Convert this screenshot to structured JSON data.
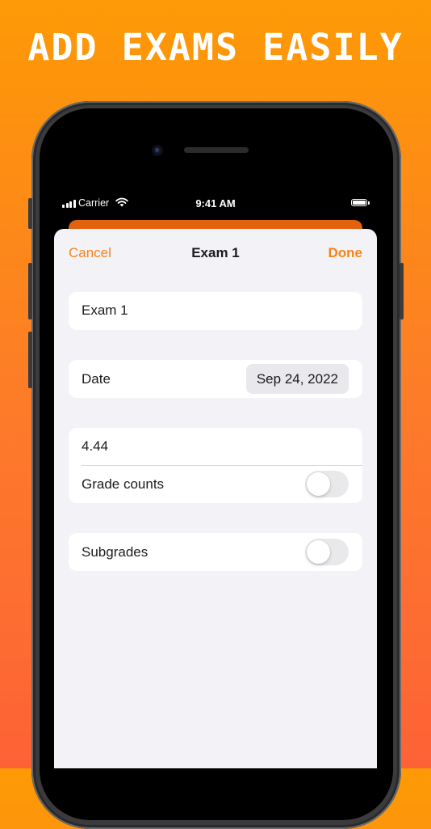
{
  "promo": {
    "headline": "ADD EXAMS EASILY"
  },
  "status_bar": {
    "carrier": "Carrier",
    "time": "9:41 AM",
    "signal_icon": "signal-bars-icon",
    "wifi_icon": "wifi-icon",
    "battery_icon": "battery-icon"
  },
  "nav": {
    "cancel_label": "Cancel",
    "title": "Exam 1",
    "done_label": "Done"
  },
  "form": {
    "name_value": "Exam 1",
    "date_label": "Date",
    "date_value": "Sep 24, 2022",
    "grade_value": "4.44",
    "grade_counts_label": "Grade counts",
    "grade_counts_on": false,
    "subgrades_label": "Subgrades",
    "subgrades_on": false
  },
  "colors": {
    "accent": "#f58418",
    "background_top": "#fd9a05",
    "background_bottom": "#fd6236"
  }
}
